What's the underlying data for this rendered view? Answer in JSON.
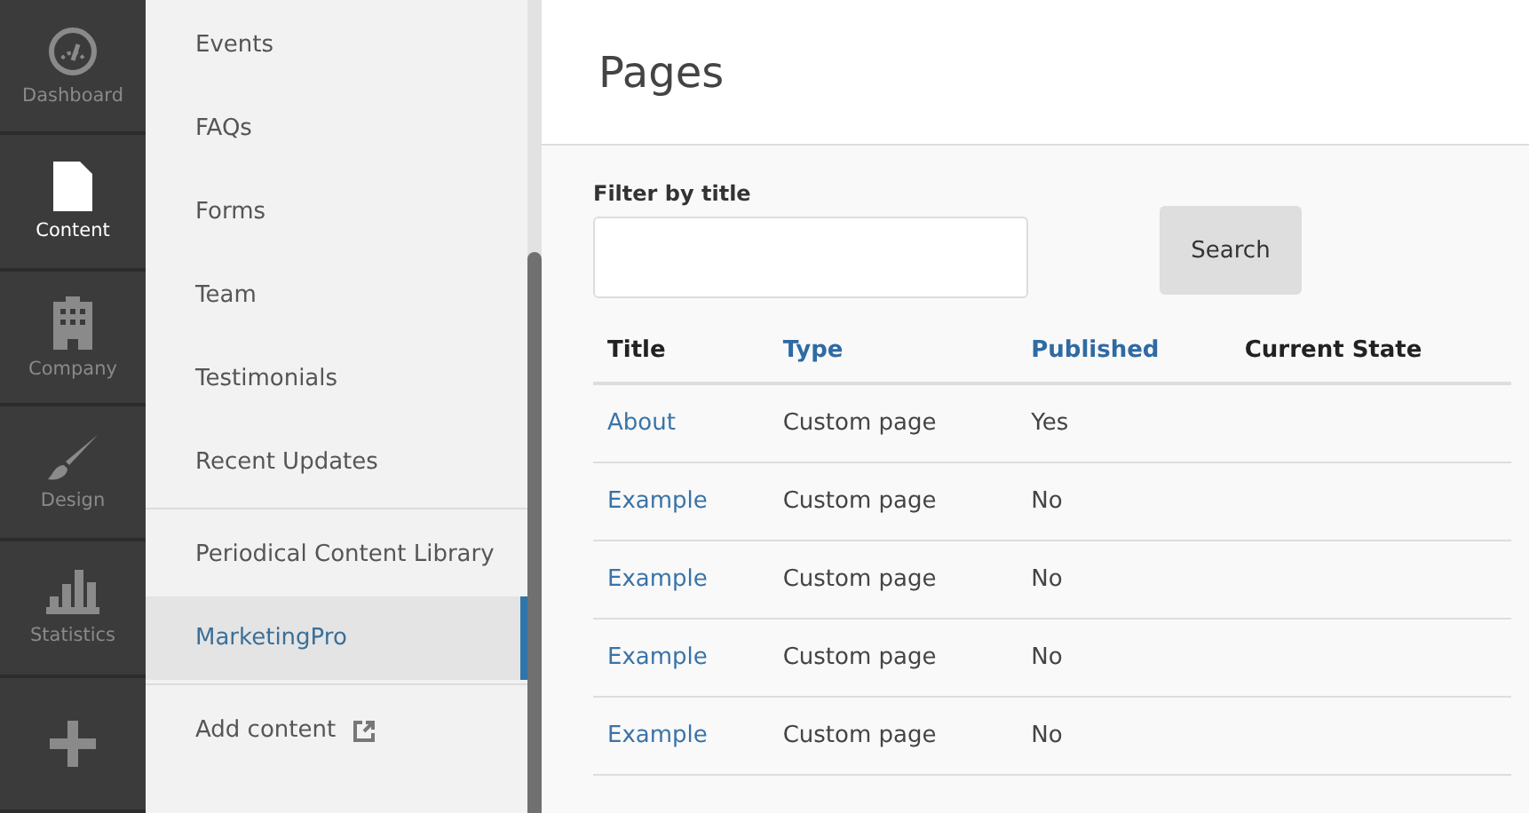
{
  "nav_rail": [
    {
      "label": "Dashboard",
      "kind": "gauge",
      "selected": false
    },
    {
      "label": "Content",
      "kind": "page",
      "selected": true
    },
    {
      "label": "Company",
      "kind": "building",
      "selected": false
    },
    {
      "label": "Design",
      "kind": "brush",
      "selected": false
    },
    {
      "label": "Statistics",
      "kind": "bars",
      "selected": false
    },
    {
      "kind": "plus",
      "selected": false
    }
  ],
  "sidebar": {
    "groups": [
      [
        {
          "label": "Events",
          "selected": false
        },
        {
          "label": "FAQs",
          "selected": false
        },
        {
          "label": "Forms",
          "selected": false
        },
        {
          "label": "Team",
          "selected": false
        },
        {
          "label": "Testimonials",
          "selected": false
        },
        {
          "label": "Recent Updates",
          "selected": false
        }
      ],
      [
        {
          "label": "Periodical Content Library",
          "selected": false
        },
        {
          "label": "MarketingPro",
          "selected": true
        }
      ]
    ],
    "add_content": "Add content"
  },
  "page_title": "Pages",
  "filter": {
    "label": "Filter by title",
    "button": "Search"
  },
  "table": {
    "columns": [
      {
        "label": "Title",
        "sortable": false
      },
      {
        "label": "Type",
        "sortable": true
      },
      {
        "label": "Published",
        "sortable": true
      },
      {
        "label": "Current State",
        "sortable": false
      }
    ],
    "rows": [
      [
        "About",
        "Custom page",
        "Yes"
      ],
      [
        "Example",
        "Custom page",
        "No"
      ],
      [
        "Example",
        "Custom page",
        "No"
      ],
      [
        "Example",
        "Custom page",
        "No"
      ],
      [
        "Example",
        "Custom page",
        "No"
      ]
    ]
  }
}
